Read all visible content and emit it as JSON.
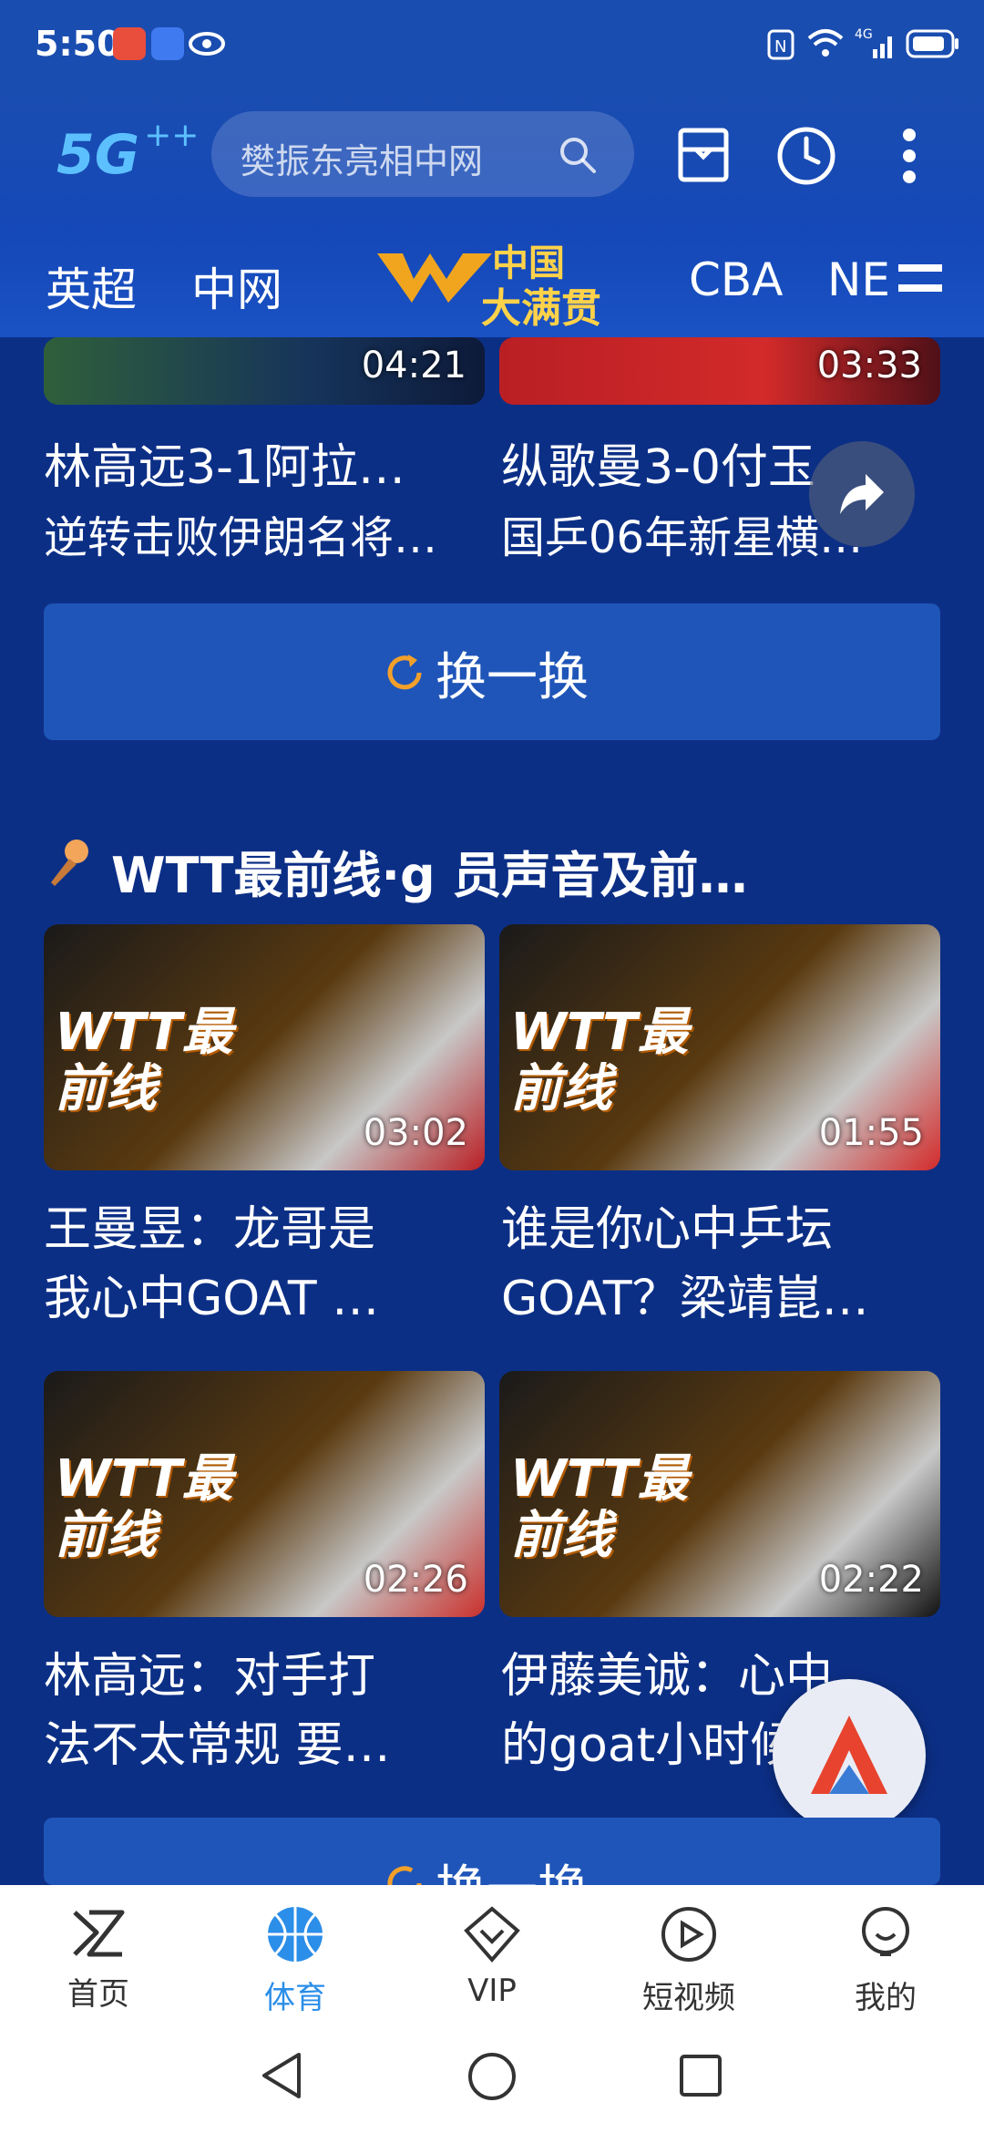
{
  "status": {
    "time": "5:50"
  },
  "header": {
    "logo_text": "5G",
    "search_placeholder": "樊振东亮相中网",
    "tabs": [
      "英超",
      "中网",
      "CBA",
      "NE"
    ],
    "center_logo_top": "中国",
    "center_logo_bottom": "大满贯"
  },
  "section1": {
    "cards": [
      {
        "duration": "04:21",
        "title": "林高远3-1阿拉…",
        "subtitle": "逆转击败伊朗名将…"
      },
      {
        "duration": "03:33",
        "title": "纵歌曼3-0付玉",
        "subtitle": "国乒06年新星横…"
      }
    ],
    "refresh_label": "换一换"
  },
  "section2": {
    "title": "WTT最前线·g   员声音及前…",
    "cards": [
      {
        "duration": "03:02",
        "title_line1": "王曼昱：龙哥是",
        "title_line2": "我心中GOAT …",
        "thumb_text": "WTT最前线"
      },
      {
        "duration": "01:55",
        "title_line1": "谁是你心中乒坛",
        "title_line2": "GOAT？梁靖崑…",
        "thumb_text": "WTT最前线"
      },
      {
        "duration": "02:26",
        "title_line1": "林高远：对手打",
        "title_line2": "法不太常规 要…",
        "thumb_text": "WTT最前线"
      },
      {
        "duration": "02:22",
        "title_line1": "伊藤美诚：心中",
        "title_line2": "的goat小时候…",
        "thumb_text": "WTT最前线"
      }
    ],
    "refresh_label": "换一换"
  },
  "bottom_nav": {
    "items": [
      {
        "label": "首页",
        "icon": "home-icon"
      },
      {
        "label": "体育",
        "icon": "sports-ball-icon",
        "active": true
      },
      {
        "label": "VIP",
        "icon": "vip-icon"
      },
      {
        "label": "短视频",
        "icon": "short-video-icon"
      },
      {
        "label": "我的",
        "icon": "profile-icon"
      }
    ]
  },
  "colors": {
    "accent": "#2b8ee8",
    "bg": "#0c2f86",
    "header": "#1a4db0",
    "card": "#1f55b8"
  }
}
